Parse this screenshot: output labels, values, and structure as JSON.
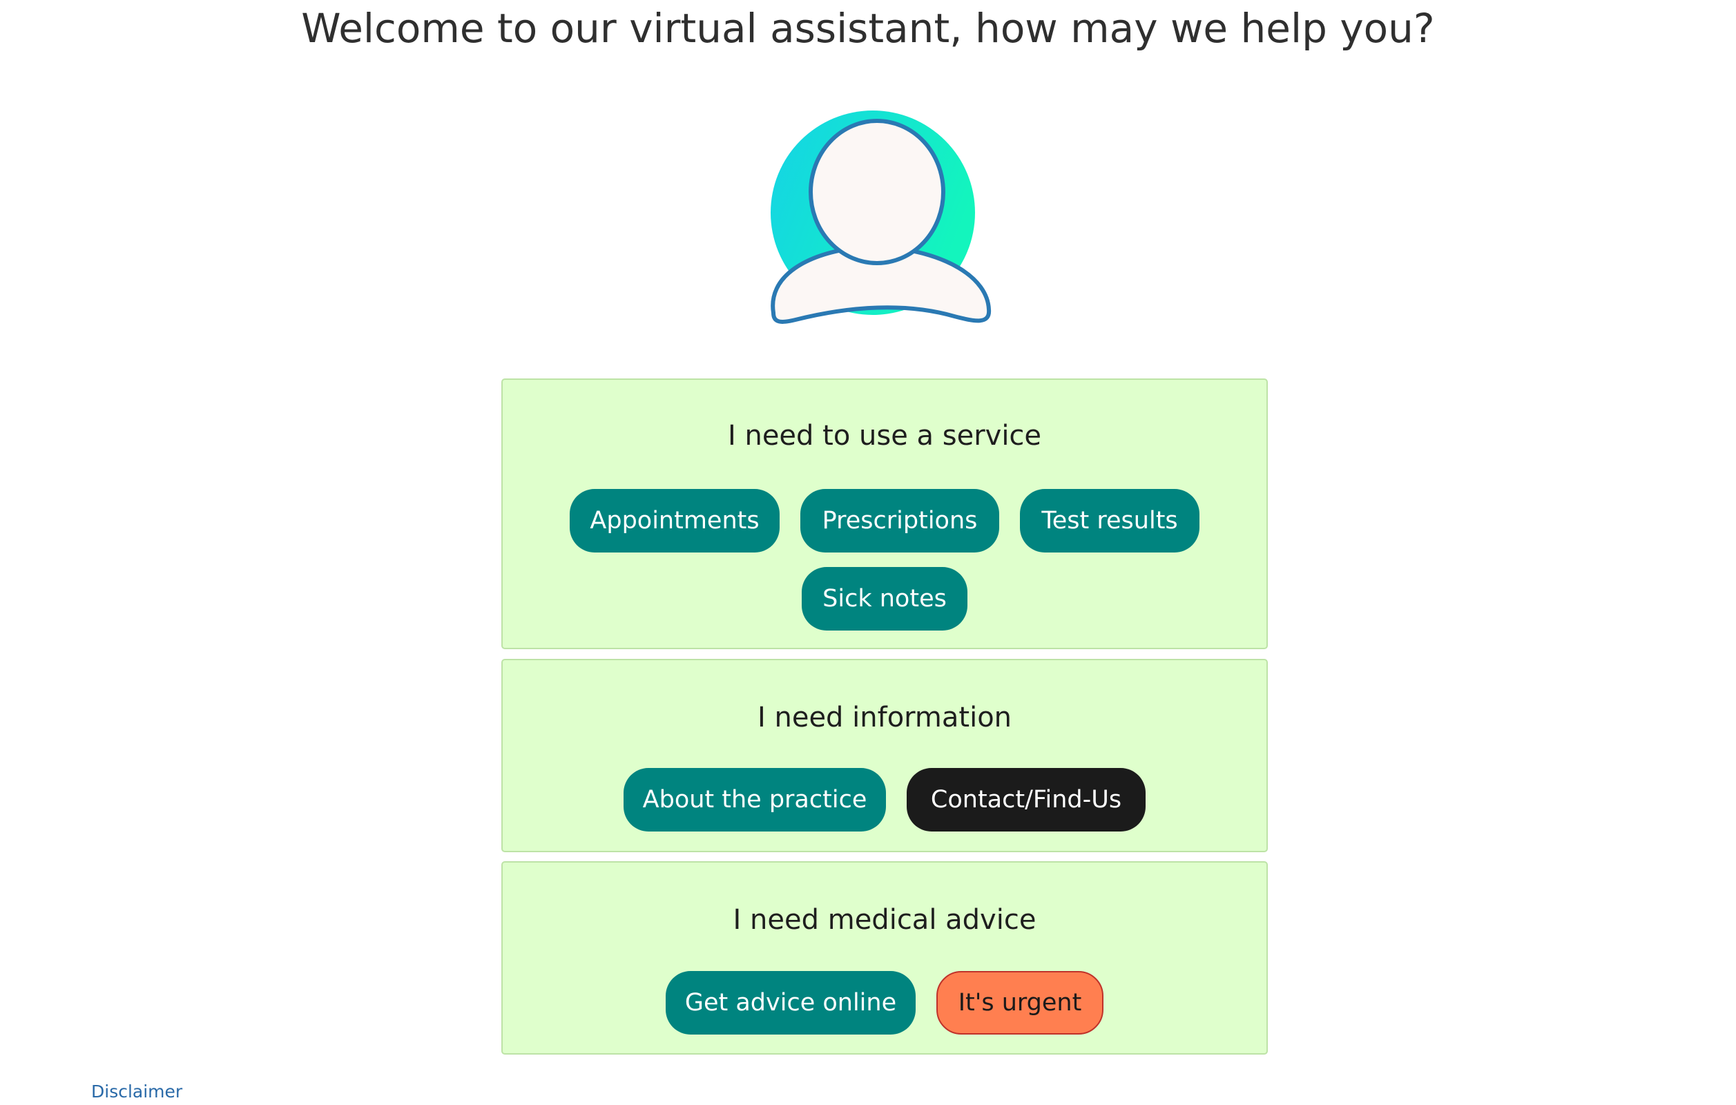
{
  "header": {
    "title": "Welcome to our virtual assistant, how may we help you?"
  },
  "avatar": {
    "icon": "user-avatar-icon",
    "gradient_start": "#15d3e6",
    "gradient_end": "#13f5bd",
    "outline": "#2a79b3",
    "fill": "#fcf7f5"
  },
  "sections": {
    "service": {
      "heading": "I need to use a service",
      "buttons": [
        "Appointments",
        "Prescriptions",
        "Test results",
        "Sick notes"
      ]
    },
    "information": {
      "heading": "I need information",
      "buttons": [
        "About the practice",
        "Contact/Find-Us"
      ]
    },
    "medical": {
      "heading": "I need medical advice",
      "buttons": [
        "Get advice online",
        "It's urgent"
      ]
    }
  },
  "footer": {
    "disclaimer": "Disclaimer"
  },
  "colors": {
    "panel_bg": "#dfffcc",
    "panel_border": "#bde3a6",
    "button_teal": "#00847f",
    "button_dark": "#1b1b1b",
    "button_urgent": "#ff7f50",
    "link": "#2a6aa8"
  }
}
